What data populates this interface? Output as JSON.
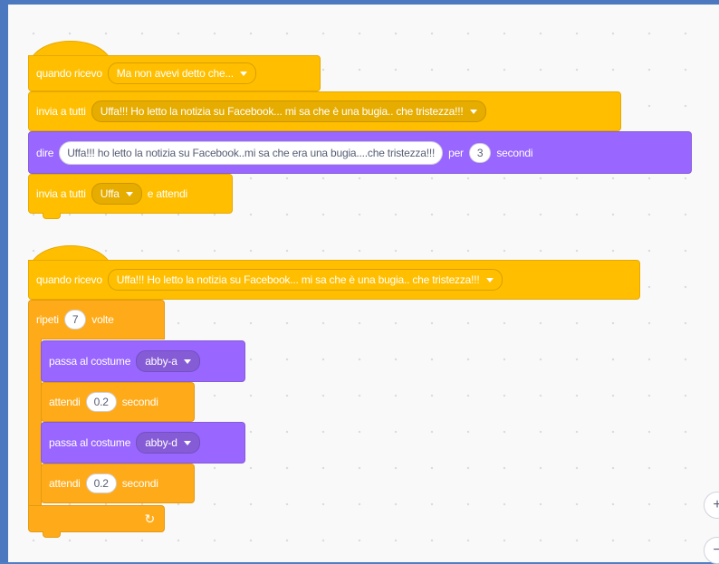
{
  "script1": {
    "hat_label": "quando ricevo",
    "hat_message": "Ma non avevi detto che...",
    "broadcast1_label": "invia a tutti",
    "broadcast1_message": "Uffa!!! Ho letto la notizia su Facebook... mi sa che è una bugia.. che tristezza!!!",
    "say_label": "dire",
    "say_text": "Uffa!!! ho letto la notizia su Facebook..mi sa che era una bugia....che tristezza!!!",
    "say_for": "per",
    "say_secs": "3",
    "say_secs_label": "secondi",
    "broadcast2_label": "invia a tutti",
    "broadcast2_message": "Uffa",
    "broadcast2_wait": "e attendi"
  },
  "script2": {
    "hat_label": "quando ricevo",
    "hat_message": "Uffa!!! Ho letto la notizia su Facebook... mi sa che è una bugia.. che tristezza!!!",
    "repeat_label": "ripeti",
    "repeat_count": "7",
    "repeat_times": "volte",
    "costume1_label": "passa al costume",
    "costume1_value": "abby-a",
    "wait1_label": "attendi",
    "wait1_value": "0.2",
    "wait1_unit": "secondi",
    "costume2_label": "passa al costume",
    "costume2_value": "abby-d",
    "wait2_label": "attendi",
    "wait2_value": "0.2",
    "wait2_unit": "secondi",
    "loop_icon": "repeat-arrow-icon"
  },
  "colors": {
    "events": "#ffbf00",
    "control": "#ffab19",
    "looks": "#9966ff",
    "frame": "#4c78c0"
  }
}
